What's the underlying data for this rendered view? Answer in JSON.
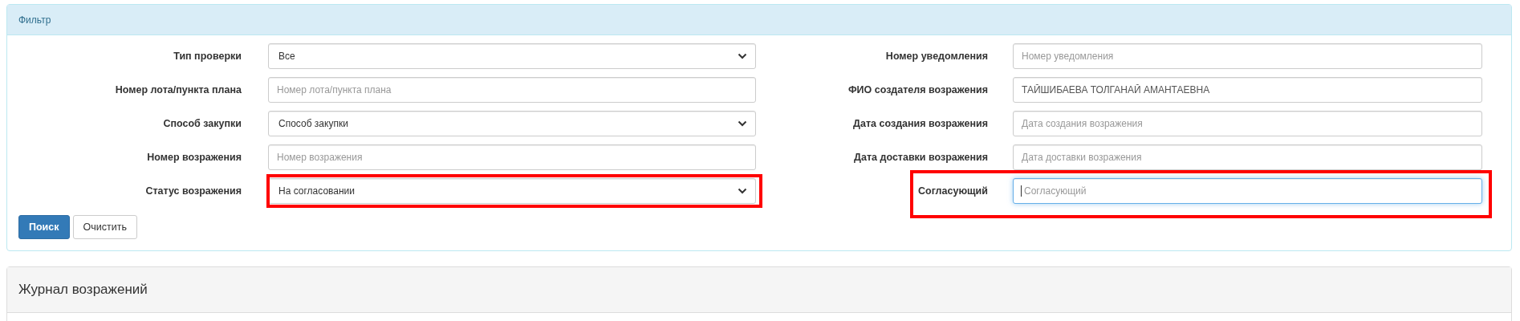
{
  "filter_panel": {
    "title": "Фильтр",
    "left_fields": [
      {
        "label": "Тип проверки",
        "kind": "select",
        "value": "Все",
        "highlighted": false
      },
      {
        "label": "Номер лота/пункта плана",
        "kind": "input",
        "placeholder": "Номер лота/пункта плана",
        "highlighted": false,
        "focused": false
      },
      {
        "label": "Способ закупки",
        "kind": "select",
        "value": "Способ закупки",
        "highlighted": false
      },
      {
        "label": "Номер возражения",
        "kind": "input",
        "placeholder": "Номер возражения",
        "highlighted": false,
        "focused": false
      },
      {
        "label": "Статус возражения",
        "kind": "select",
        "value": "На согласовании",
        "highlighted": true
      }
    ],
    "right_fields": [
      {
        "label": "Номер уведомления",
        "kind": "input",
        "placeholder": "Номер уведомления",
        "highlighted": false,
        "focused": false
      },
      {
        "label": "ФИО создателя возражения",
        "kind": "input",
        "value": "ТАЙШИБАЕВА ТОЛГАНАЙ АМАНТАЕВНА",
        "highlighted": false,
        "focused": false
      },
      {
        "label": "Дата создания возражения",
        "kind": "input",
        "placeholder": "Дата создания возражения",
        "highlighted": false,
        "focused": false
      },
      {
        "label": "Дата доставки возражения",
        "kind": "input",
        "placeholder": "Дата доставки возражения",
        "highlighted": false,
        "focused": false
      },
      {
        "label": "Согласующий",
        "kind": "input",
        "placeholder": "Согласующий",
        "highlighted": true,
        "focused": true
      }
    ],
    "buttons": [
      {
        "label": "Поиск",
        "kind": "primary"
      },
      {
        "label": "Очистить",
        "kind": "default"
      }
    ]
  },
  "journal_panel": {
    "title": "Журнал возражений"
  }
}
